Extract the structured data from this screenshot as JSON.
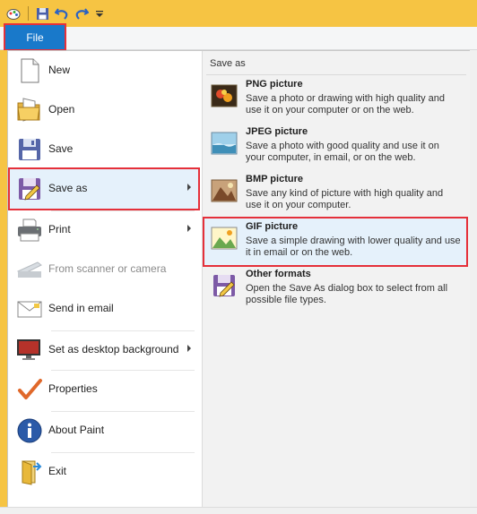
{
  "file_tab": {
    "label": "File"
  },
  "menu": {
    "items": [
      {
        "label": "New",
        "icon": "new-document-icon"
      },
      {
        "label": "Open",
        "icon": "open-folder-icon"
      },
      {
        "label": "Save",
        "icon": "floppy-disk-icon"
      },
      {
        "label": "Save as",
        "icon": "save-as-icon"
      },
      {
        "label": "Print",
        "icon": "printer-icon"
      },
      {
        "label": "From scanner or camera",
        "icon": "scanner-icon"
      },
      {
        "label": "Send in email",
        "icon": "email-icon"
      },
      {
        "label": "Set as desktop background",
        "icon": "desktop-background-icon"
      },
      {
        "label": "Properties",
        "icon": "checkmark-icon"
      },
      {
        "label": "About Paint",
        "icon": "info-icon"
      },
      {
        "label": "Exit",
        "icon": "exit-icon"
      }
    ]
  },
  "save_as": {
    "title": "Save as",
    "options": [
      {
        "title": "PNG picture",
        "desc": "Save a photo or drawing with high quality and use it on your computer or on the web.",
        "icon": "png-picture-icon"
      },
      {
        "title": "JPEG picture",
        "desc": "Save a photo with good quality and use it on your computer, in email, or on the web.",
        "icon": "jpeg-picture-icon"
      },
      {
        "title": "BMP picture",
        "desc": "Save any kind of picture with high quality and use it on your computer.",
        "icon": "bmp-picture-icon"
      },
      {
        "title": "GIF picture",
        "desc": "Save a simple drawing with lower quality and use it in email or on the web.",
        "icon": "gif-picture-icon"
      },
      {
        "title": "Other formats",
        "desc": "Open the Save As dialog box to select from all possible file types.",
        "icon": "other-formats-icon"
      }
    ]
  },
  "colors": {
    "accent": "#1979ca",
    "titlebar": "#f6c443",
    "highlight": "#e5303a",
    "selection": "#e5f1fb"
  }
}
